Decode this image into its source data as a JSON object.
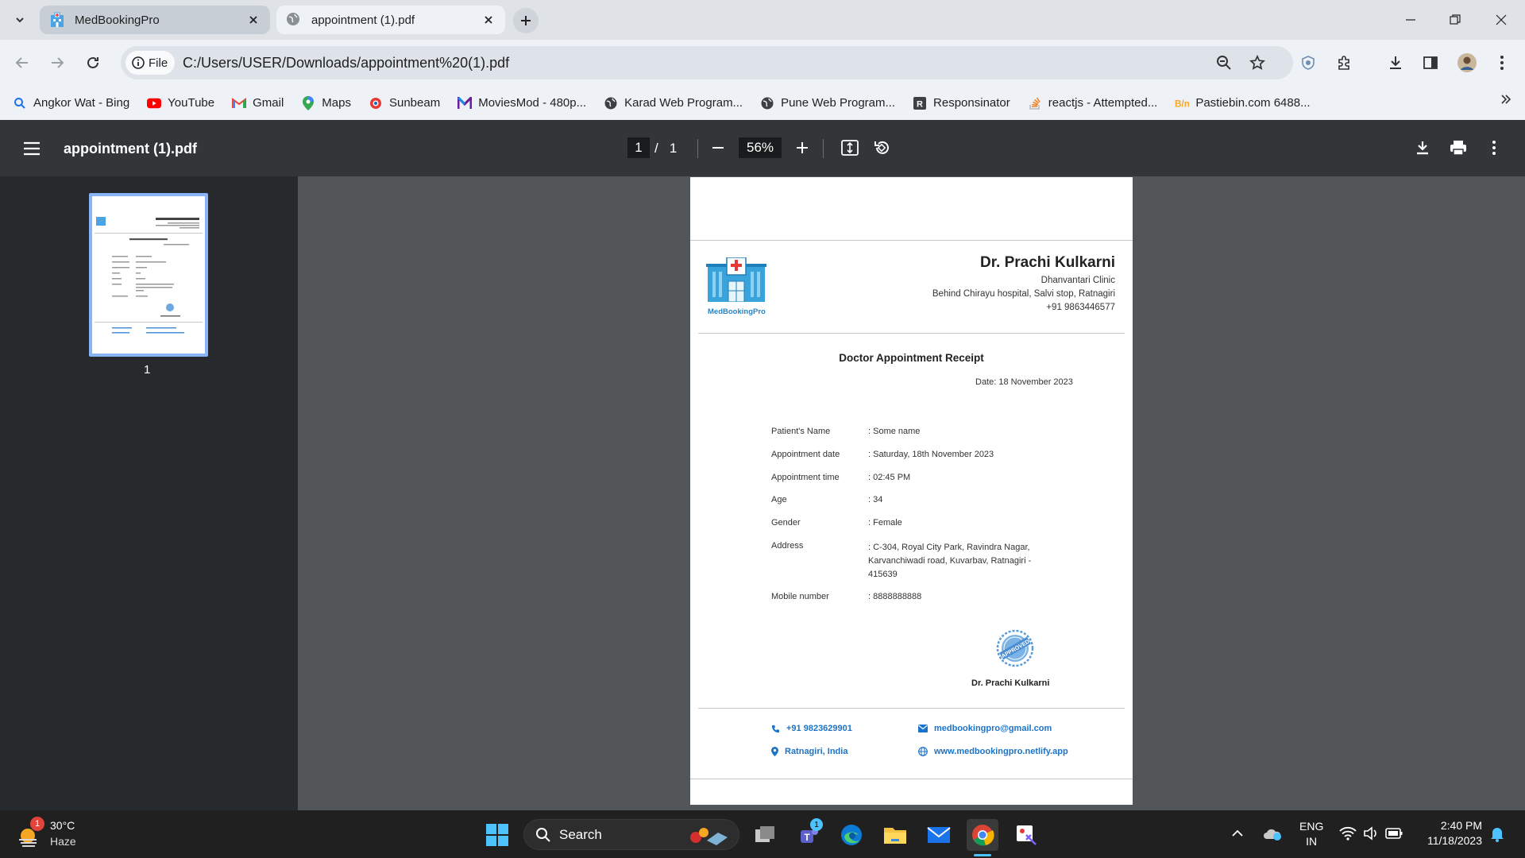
{
  "tabs": [
    {
      "title": "MedBookingPro",
      "active": false
    },
    {
      "title": "appointment (1).pdf",
      "active": true
    }
  ],
  "omnibox": {
    "chip": "File",
    "url": "C:/Users/USER/Downloads/appointment%20(1).pdf"
  },
  "bookmarks": [
    {
      "label": "Angkor Wat - Bing",
      "icon": "bing-search-icon"
    },
    {
      "label": "YouTube",
      "icon": "youtube-icon"
    },
    {
      "label": "Gmail",
      "icon": "gmail-icon"
    },
    {
      "label": "Maps",
      "icon": "maps-icon"
    },
    {
      "label": "Sunbeam",
      "icon": "sunbeam-icon"
    },
    {
      "label": "MoviesMod - 480p...",
      "icon": "moviesmod-icon"
    },
    {
      "label": "Karad Web Program...",
      "icon": "globe-icon"
    },
    {
      "label": "Pune Web Program...",
      "icon": "globe-icon"
    },
    {
      "label": "Responsinator",
      "icon": "responsinator-icon"
    },
    {
      "label": "reactjs - Attempted...",
      "icon": "stackoverflow-icon"
    },
    {
      "label": "Pastiebin.com 6488...",
      "icon": "pastebin-icon"
    }
  ],
  "pdf": {
    "title": "appointment (1).pdf",
    "page_current": "1",
    "page_sep": "/",
    "page_total": "1",
    "zoom": "56%",
    "thumb_label": "1"
  },
  "doc": {
    "logo_text": "MedBookingPro",
    "doctor_name": "Dr. Prachi Kulkarni",
    "clinic": "Dhanvantari Clinic",
    "address": "Behind Chirayu hospital, Salvi stop, Ratnagiri",
    "phone": "+91 9863446577",
    "heading": "Doctor Appointment Receipt",
    "date": "Date: 18 November 2023",
    "rows": [
      {
        "label": "Patient's Name",
        "value": ": Some name"
      },
      {
        "label": "Appointment date",
        "value": ": Saturday, 18th November 2023"
      },
      {
        "label": "Appointment time",
        "value": ": 02:45 PM"
      },
      {
        "label": "Age",
        "value": ": 34"
      },
      {
        "label": "Gender",
        "value": ": Female"
      },
      {
        "label": "Address",
        "value": ": C-304, Royal City Park, Ravindra Nagar, Karvanchiwadi road, Kuvarbav, Ratnagiri - 415639"
      },
      {
        "label": "Mobile number",
        "value": ": 8888888888"
      }
    ],
    "stamp_text": "APPROVED",
    "signature_name": "Dr. Prachi Kulkarni",
    "footer": {
      "phone": "+91 9823629901",
      "email": "medbookingpro@gmail.com",
      "location": "Ratnagiri, India",
      "website": "www.medbookingpro.netlify.app"
    }
  },
  "taskbar": {
    "weather_temp": "30°C",
    "weather_desc": "Haze",
    "weather_badge": "1",
    "search": "Search",
    "teams_badge": "1",
    "lang_top": "ENG",
    "lang_bottom": "IN",
    "time": "2:40 PM",
    "date": "11/18/2023"
  },
  "colors": {
    "accent_link": "#1a73c8",
    "pdf_toolbar": "#323639",
    "pdf_canvas": "#525659",
    "thumb_border": "#8ab4f8"
  }
}
